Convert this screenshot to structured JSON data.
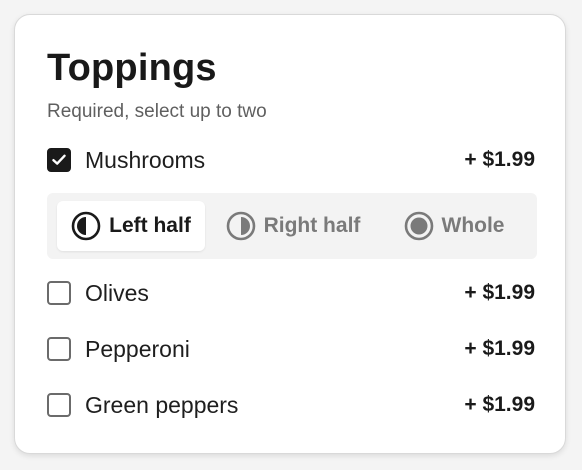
{
  "toppings": {
    "title": "Toppings",
    "subtitle": "Required, select up to two",
    "items": [
      {
        "label": "Mushrooms",
        "price": "+ $1.99",
        "checked": true
      },
      {
        "label": "Olives",
        "price": "+ $1.99",
        "checked": false
      },
      {
        "label": "Pepperoni",
        "price": "+ $1.99",
        "checked": false
      },
      {
        "label": "Green peppers",
        "price": "+ $1.99",
        "checked": false
      }
    ],
    "placement": {
      "options": [
        {
          "label": "Left half",
          "icon": "left-half-icon"
        },
        {
          "label": "Right half",
          "icon": "right-half-icon"
        },
        {
          "label": "Whole",
          "icon": "whole-icon"
        }
      ],
      "selected": "Left half"
    }
  },
  "colors": {
    "primary": "#1a1a1a",
    "muted": "#7a7a7a",
    "segment_background": "#f3f3f3"
  }
}
